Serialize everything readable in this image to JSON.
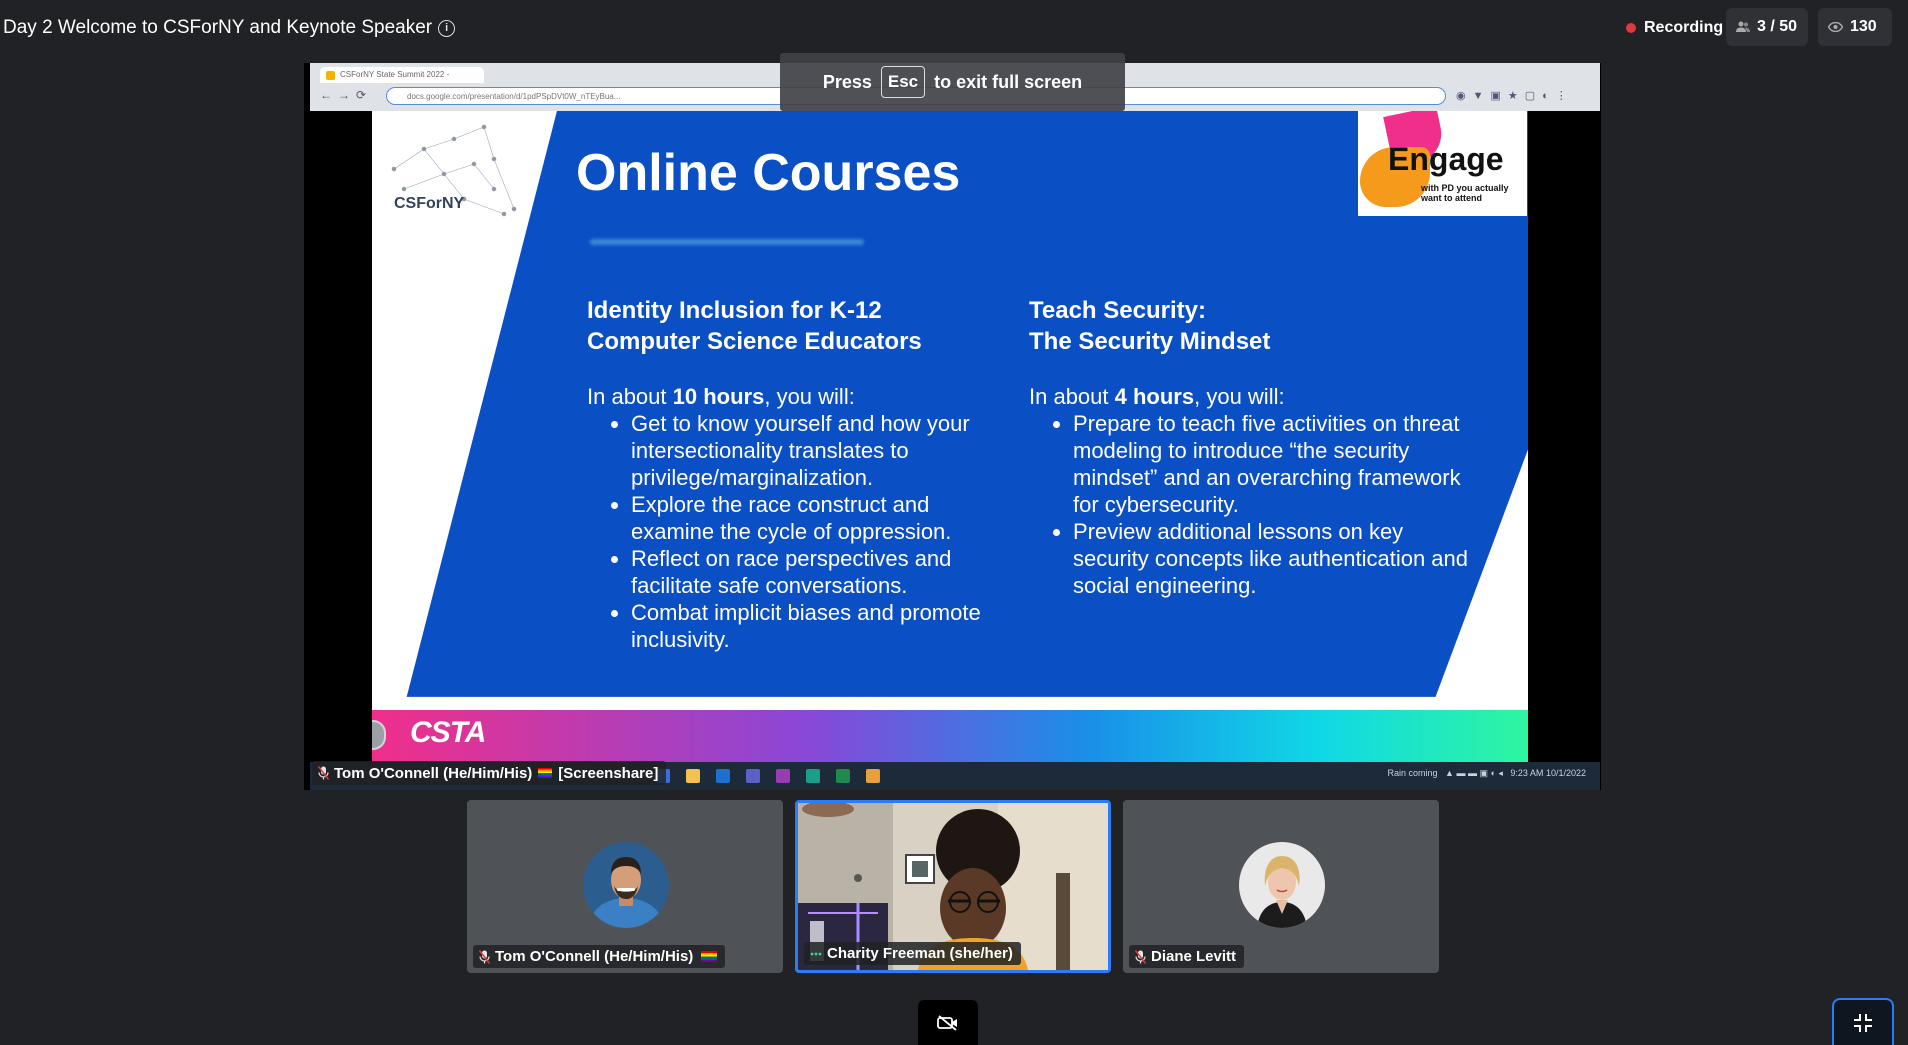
{
  "meeting": {
    "title": "Day 2 Welcome to CSForNY and Keynote Speaker",
    "recording_label": "Recording",
    "participants": "3 / 50",
    "viewers": "130"
  },
  "browser": {
    "tab_title": "CSForNY State Summit 2022 -",
    "url": "docs.google.com/presentation/d/1pdPSpDVt0W_nTEyBua..."
  },
  "fullscreen_banner": {
    "press": "Press",
    "key": "Esc",
    "suffix": "to exit full screen"
  },
  "slide": {
    "heading": "Online Courses",
    "logo_text": "CSForNY",
    "engage_word": "Engage",
    "engage_tagline": "with PD you actually want to attend",
    "footer_logo": "CSTA",
    "left": {
      "title_line1": "Identity Inclusion for K-12",
      "title_line2": "Computer Science Educators",
      "intro_prefix": "In about ",
      "intro_bold": "10 hours",
      "intro_suffix": ", you will:",
      "bullets": [
        "Get to know yourself and how your intersectionality translates to privilege/marginalization.",
        "Explore the race construct and examine the cycle of oppression.",
        "Reflect on race perspectives and facilitate safe conversations.",
        "Combat implicit biases and promote inclusivity."
      ]
    },
    "right": {
      "title_line1": "Teach Security:",
      "title_line2": "The Security Mindset",
      "intro_prefix": "In about ",
      "intro_bold": "4 hours",
      "intro_suffix": ", you will:",
      "bullets": [
        "Prepare to teach five activities on threat modeling to introduce “the security mindset” and an overarching framework for cybersecurity.",
        "Preview additional lessons on key security concepts like authentication and social engineering."
      ]
    }
  },
  "taskbar": {
    "weather": "Rain coming",
    "time": "9:23 AM",
    "date": "10/1/2022"
  },
  "screenshare_label": {
    "name": "Tom O'Connell (He/Him/His)",
    "tag": "[Screenshare]"
  },
  "participants": [
    {
      "name": "Tom O'Connell (He/Him/His)",
      "muted": true
    },
    {
      "name": "Charity Freeman (she/her)",
      "muted": false,
      "speaking": true
    },
    {
      "name": "Diane Levitt",
      "muted": true
    }
  ],
  "colors": {
    "background": "#202225",
    "accent": "#2a7df6",
    "recording": "#e0393e",
    "slide_blue": "#0b4fc4"
  }
}
